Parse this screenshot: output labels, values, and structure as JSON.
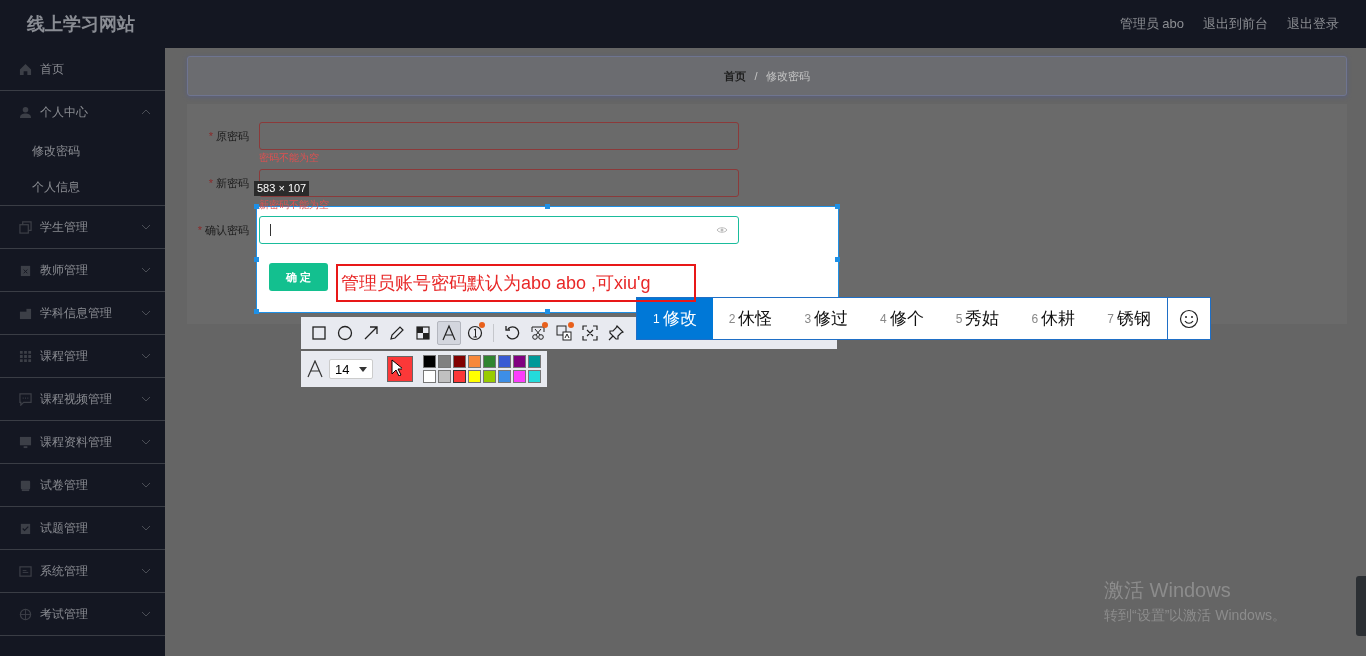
{
  "header": {
    "title": "线上学习网站",
    "links": [
      "管理员 abo",
      "退出到前台",
      "退出登录"
    ]
  },
  "sidebar": {
    "items": [
      {
        "label": "首页",
        "kind": "link"
      },
      {
        "label": "个人中心",
        "kind": "group",
        "expanded": true,
        "children": [
          {
            "label": "修改密码"
          },
          {
            "label": "个人信息"
          }
        ]
      },
      {
        "label": "学生管理",
        "kind": "group",
        "expanded": false
      },
      {
        "label": "教师管理",
        "kind": "group",
        "expanded": false
      },
      {
        "label": "学科信息管理",
        "kind": "group",
        "expanded": false
      },
      {
        "label": "课程管理",
        "kind": "group",
        "expanded": false
      },
      {
        "label": "课程视频管理",
        "kind": "group",
        "expanded": false
      },
      {
        "label": "课程资料管理",
        "kind": "group",
        "expanded": false
      },
      {
        "label": "试卷管理",
        "kind": "group",
        "expanded": false
      },
      {
        "label": "试题管理",
        "kind": "group",
        "expanded": false
      },
      {
        "label": "系统管理",
        "kind": "group",
        "expanded": false
      },
      {
        "label": "考试管理",
        "kind": "group",
        "expanded": false
      }
    ]
  },
  "breadcrumb": {
    "items": [
      "首页",
      "修改密码"
    ],
    "separator": "/"
  },
  "form": {
    "fields": [
      {
        "label": "原密码",
        "required_mark": "*",
        "focused": false,
        "error": "密码不能为空"
      },
      {
        "label": "新密码",
        "required_mark": "*",
        "focused": false,
        "error": "新密码不能为空"
      },
      {
        "label": "确认密码",
        "required_mark": "*",
        "focused": true
      }
    ],
    "submit": "确 定"
  },
  "capture": {
    "size_label": "583 × 107",
    "annotation": "管理员账号密码默认为abo abo ,可xiu'g",
    "tools": [
      {
        "kind": "rectangle",
        "selected": false,
        "badge": false
      },
      {
        "kind": "circle",
        "selected": false,
        "badge": false
      },
      {
        "kind": "arrow",
        "selected": false,
        "badge": false
      },
      {
        "kind": "pencil",
        "selected": false,
        "badge": false
      },
      {
        "kind": "mosaic",
        "selected": false,
        "badge": false
      },
      {
        "kind": "text",
        "selected": true,
        "badge": false
      },
      {
        "kind": "number",
        "selected": false,
        "badge": true
      },
      {
        "kind": "separator"
      },
      {
        "kind": "undo",
        "selected": false,
        "badge": false
      },
      {
        "kind": "scissors",
        "selected": false,
        "badge": true
      },
      {
        "kind": "translate",
        "selected": false,
        "badge": true
      },
      {
        "kind": "scan",
        "selected": false,
        "badge": false
      },
      {
        "kind": "pin",
        "selected": false,
        "badge": false
      }
    ],
    "font_size": "14",
    "palette": [
      {
        "color": "#000000",
        "selected": false
      },
      {
        "color": "#808080",
        "selected": false
      },
      {
        "color": "#800000",
        "selected": false
      },
      {
        "color": "#f7883a",
        "selected": false
      },
      {
        "color": "#308430",
        "selected": false
      },
      {
        "color": "#385ad3",
        "selected": false
      },
      {
        "color": "#800080",
        "selected": false
      },
      {
        "color": "#009999",
        "selected": false
      },
      {
        "color": "#ffffff",
        "selected": false
      },
      {
        "color": "#c0c0c0",
        "selected": false
      },
      {
        "color": "#fb3838",
        "selected": true
      },
      {
        "color": "#ffff00",
        "selected": false
      },
      {
        "color": "#99cc00",
        "selected": false
      },
      {
        "color": "#3d8ee6",
        "selected": false
      },
      {
        "color": "#fb3dfb",
        "selected": false
      },
      {
        "color": "#23dbdb",
        "selected": false
      }
    ]
  },
  "ime": {
    "candidates": [
      {
        "index": "1",
        "text": "修改",
        "selected": true
      },
      {
        "index": "2",
        "text": "休怪",
        "selected": false
      },
      {
        "index": "3",
        "text": "修过",
        "selected": false
      },
      {
        "index": "4",
        "text": "修个",
        "selected": false
      },
      {
        "index": "5",
        "text": "秀姑",
        "selected": false
      },
      {
        "index": "6",
        "text": "休耕",
        "selected": false
      },
      {
        "index": "7",
        "text": "锈钢",
        "selected": false
      }
    ]
  },
  "activation": {
    "title": "激活 Windows",
    "hint": "转到“设置”以激活 Windows。"
  }
}
